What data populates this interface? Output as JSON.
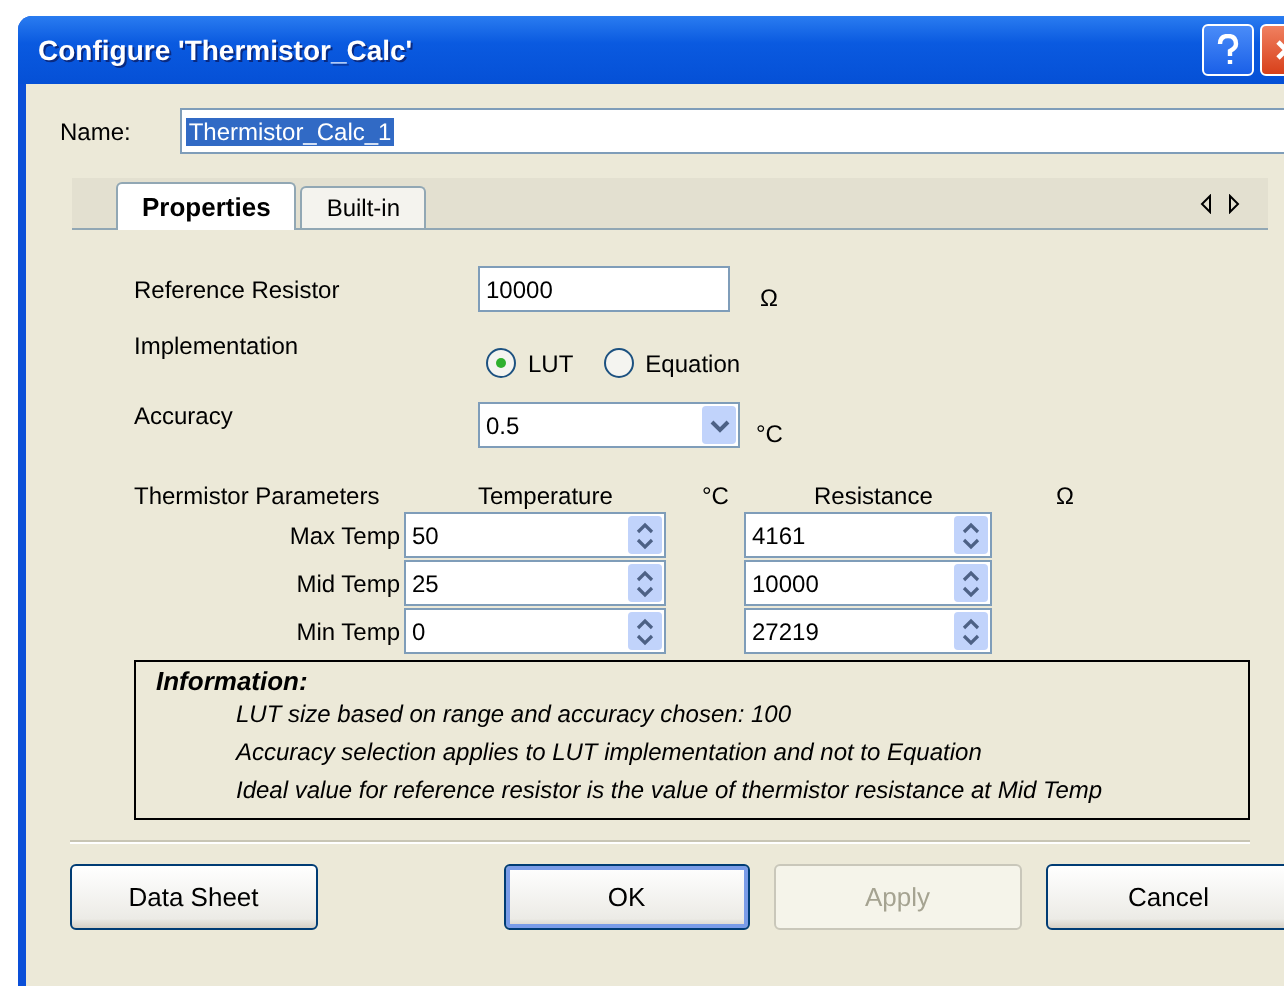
{
  "window": {
    "title": "Configure 'Thermistor_Calc'"
  },
  "name_field": {
    "label": "Name:",
    "value": "Thermistor_Calc_1",
    "highlighted": true
  },
  "tabs": [
    {
      "label": "Properties",
      "selected": true
    },
    {
      "label": "Built-in",
      "selected": false
    }
  ],
  "reference_resistor": {
    "label": "Reference Resistor",
    "value": "10000",
    "unit": "Ω"
  },
  "implementation": {
    "label": "Implementation",
    "options": [
      {
        "label": "LUT",
        "selected": true
      },
      {
        "label": "Equation",
        "selected": false
      }
    ]
  },
  "accuracy": {
    "label": "Accuracy",
    "value": "0.5",
    "unit": "°C"
  },
  "parameters": {
    "label": "Thermistor Parameters",
    "columns": [
      {
        "label": "Temperature",
        "unit": "°C"
      },
      {
        "label": "Resistance",
        "unit": "Ω"
      }
    ],
    "rows": [
      {
        "label": "Max Temp",
        "temperature": "50",
        "resistance": "4161"
      },
      {
        "label": "Mid Temp",
        "temperature": "25",
        "resistance": "10000"
      },
      {
        "label": "Min Temp",
        "temperature": "0",
        "resistance": "27219"
      }
    ]
  },
  "information": {
    "title": "Information:",
    "lines": [
      "LUT size based on range and accuracy chosen:  100",
      "Accuracy selection applies to LUT implementation and not to Equation",
      "Ideal value for reference resistor is the value of thermistor resistance at Mid Temp"
    ]
  },
  "buttons": [
    {
      "label": "Data Sheet",
      "default": false,
      "disabled": false
    },
    {
      "label": "OK",
      "default": true,
      "disabled": false
    },
    {
      "label": "Apply",
      "default": false,
      "disabled": true
    },
    {
      "label": "Cancel",
      "default": false,
      "disabled": false
    }
  ]
}
